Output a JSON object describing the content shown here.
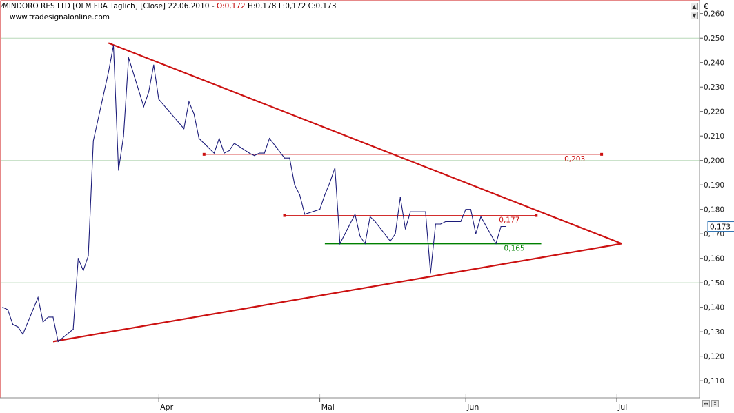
{
  "header": {
    "instrument": "MINDORO RES LTD [OLM FRA  Täglich] [Close] 22.06.2010",
    "open": "O:0,172",
    "rest": "H:0,178 L:0,172 C:0,173",
    "source": "www.tradesignalonline.com"
  },
  "currency_label": "€",
  "controls": {
    "scroll_up": "▲",
    "scroll_down": "▼",
    "zoom_x": "↔",
    "zoom_y": "↕"
  },
  "colors": {
    "price": "#1c1c7a",
    "trend": "#cc1111",
    "support": "#008000",
    "grid": "#b8d8b8",
    "last": "#2a6fb0"
  },
  "chart_data": {
    "type": "line",
    "title": "MINDORO RES LTD [OLM FRA  Täglich] [Close] 22.06.2010",
    "ylim": [
      0.103,
      0.265
    ],
    "y_ticks": [
      "0,110",
      "0,120",
      "0,130",
      "0,140",
      "0,150",
      "0,160",
      "0,170",
      "0,180",
      "0,190",
      "0,200",
      "0,210",
      "0,220",
      "0,230",
      "0,240",
      "0,250",
      "0,260"
    ],
    "y_tick_values": [
      0.11,
      0.12,
      0.13,
      0.14,
      0.15,
      0.16,
      0.17,
      0.18,
      0.19,
      0.2,
      0.21,
      0.22,
      0.23,
      0.24,
      0.25,
      0.26
    ],
    "x_range": [
      "2010-03-01",
      "2010-07-18"
    ],
    "month_ticks": [
      {
        "label": "Apr",
        "date": "2010-04-01"
      },
      {
        "label": "Mai",
        "date": "2010-05-03"
      },
      {
        "label": "Jun",
        "date": "2010-06-01"
      },
      {
        "label": "Jul",
        "date": "2010-07-01"
      }
    ],
    "grid_y": [
      0.15,
      0.2,
      0.25
    ],
    "series": [
      {
        "points": [
          [
            "2010-03-01",
            0.14
          ],
          [
            "2010-03-02",
            0.139
          ],
          [
            "2010-03-03",
            0.133
          ],
          [
            "2010-03-04",
            0.132
          ],
          [
            "2010-03-05",
            0.129
          ],
          [
            "2010-03-08",
            0.144
          ],
          [
            "2010-03-09",
            0.134
          ],
          [
            "2010-03-10",
            0.136
          ],
          [
            "2010-03-11",
            0.136
          ],
          [
            "2010-03-12",
            0.126
          ],
          [
            "2010-03-15",
            0.131
          ],
          [
            "2010-03-16",
            0.16
          ],
          [
            "2010-03-17",
            0.155
          ],
          [
            "2010-03-18",
            0.161
          ],
          [
            "2010-03-19",
            0.208
          ],
          [
            "2010-03-22",
            0.236
          ],
          [
            "2010-03-23",
            0.247
          ],
          [
            "2010-03-24",
            0.196
          ],
          [
            "2010-03-25",
            0.21
          ],
          [
            "2010-03-26",
            0.242
          ],
          [
            "2010-03-29",
            0.222
          ],
          [
            "2010-03-30",
            0.228
          ],
          [
            "2010-03-31",
            0.239
          ],
          [
            "2010-04-01",
            0.225
          ],
          [
            "2010-04-06",
            0.213
          ],
          [
            "2010-04-07",
            0.224
          ],
          [
            "2010-04-08",
            0.219
          ],
          [
            "2010-04-09",
            0.209
          ],
          [
            "2010-04-12",
            0.203
          ],
          [
            "2010-04-13",
            0.209
          ],
          [
            "2010-04-14",
            0.203
          ],
          [
            "2010-04-15",
            0.204
          ],
          [
            "2010-04-16",
            0.207
          ],
          [
            "2010-04-19",
            0.203
          ],
          [
            "2010-04-20",
            0.202
          ],
          [
            "2010-04-21",
            0.203
          ],
          [
            "2010-04-22",
            0.203
          ],
          [
            "2010-04-23",
            0.209
          ],
          [
            "2010-04-26",
            0.201
          ],
          [
            "2010-04-27",
            0.201
          ],
          [
            "2010-04-28",
            0.19
          ],
          [
            "2010-04-29",
            0.186
          ],
          [
            "2010-04-30",
            0.178
          ],
          [
            "2010-05-03",
            0.18
          ],
          [
            "2010-05-04",
            0.186
          ],
          [
            "2010-05-05",
            0.191
          ],
          [
            "2010-05-06",
            0.197
          ],
          [
            "2010-05-07",
            0.166
          ],
          [
            "2010-05-10",
            0.178
          ],
          [
            "2010-05-11",
            0.169
          ],
          [
            "2010-05-12",
            0.166
          ],
          [
            "2010-05-13",
            0.177
          ],
          [
            "2010-05-14",
            0.175
          ],
          [
            "2010-05-17",
            0.167
          ],
          [
            "2010-05-18",
            0.17
          ],
          [
            "2010-05-19",
            0.185
          ],
          [
            "2010-05-20",
            0.172
          ],
          [
            "2010-05-21",
            0.179
          ],
          [
            "2010-05-24",
            0.179
          ],
          [
            "2010-05-25",
            0.154
          ],
          [
            "2010-05-26",
            0.174
          ],
          [
            "2010-05-27",
            0.174
          ],
          [
            "2010-05-28",
            0.175
          ],
          [
            "2010-05-31",
            0.175
          ],
          [
            "2010-06-01",
            0.18
          ],
          [
            "2010-06-02",
            0.18
          ],
          [
            "2010-06-03",
            0.17
          ],
          [
            "2010-06-04",
            0.177
          ],
          [
            "2010-06-07",
            0.166
          ],
          [
            "2010-06-08",
            0.173
          ],
          [
            "2010-06-09",
            0.173
          ]
        ]
      }
    ],
    "lines": [
      {
        "name": "upper-trendline",
        "from": [
          "2010-03-22",
          0.248
        ],
        "to": [
          "2010-07-02",
          0.166
        ],
        "color": "#cc1111"
      },
      {
        "name": "lower-trendline",
        "from": [
          "2010-03-11",
          0.126
        ],
        "to": [
          "2010-07-02",
          0.166
        ],
        "color": "#cc1111"
      },
      {
        "name": "resistance-0203",
        "from": [
          "2010-04-10",
          0.2025
        ],
        "to": [
          "2010-06-28",
          0.2025
        ],
        "color": "#cc1111",
        "label": "0,203"
      },
      {
        "name": "resistance-0177",
        "from": [
          "2010-04-26",
          0.1775
        ],
        "to": [
          "2010-06-15",
          0.1775
        ],
        "color": "#cc1111",
        "label": "0,177"
      },
      {
        "name": "support-0165",
        "from": [
          "2010-05-04",
          0.166
        ],
        "to": [
          "2010-06-16",
          0.166
        ],
        "color": "#008000",
        "label": "0,165"
      }
    ],
    "last_value": {
      "value": 0.173,
      "label": "0,173"
    }
  }
}
